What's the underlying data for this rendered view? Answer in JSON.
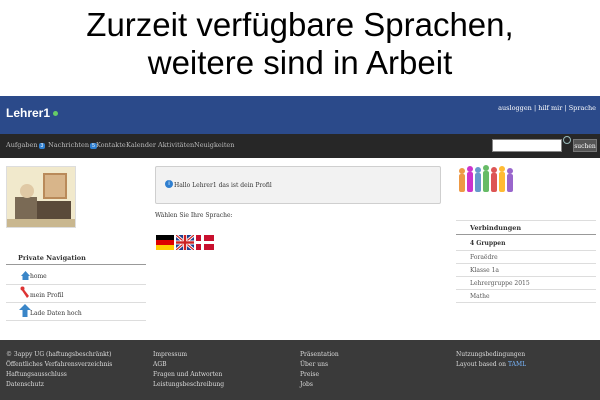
{
  "caption": {
    "line1": "Zurzeit verfügbare Sprachen,",
    "line2": "weitere sind in Arbeit"
  },
  "header": {
    "brand": "Lehrer1",
    "links": {
      "logout": "ausloggen",
      "help": "hilf mir",
      "language": "Sprache"
    }
  },
  "nav": {
    "tasks": "Aufgaben",
    "tasks_count": "3",
    "messages": "Nachrichten",
    "messages_count": "5",
    "contacts": "Kontakte",
    "calendar": "Kalender",
    "activities": "Aktivitäten",
    "news": "Neuigkeiten",
    "search_button": "suchen",
    "search_value": ""
  },
  "sidebar": {
    "title": "Private Navigation",
    "items": [
      {
        "label": "home",
        "icon": "house-icon"
      },
      {
        "label": "mein Profil",
        "icon": "wrench-icon"
      },
      {
        "label": "Lade Daten hoch",
        "icon": "upload-arrow-icon"
      }
    ]
  },
  "main": {
    "hello": "Hallo Lehrer1 das ist dein Profil",
    "lang_prompt": "Wählen Sie Ihre Sprache:",
    "flags": [
      "german-flag-icon",
      "uk-flag-icon",
      "danish-flag-icon"
    ]
  },
  "connections": {
    "title": "Verbindungen",
    "items": [
      "4 Gruppen",
      "Foraëdre",
      "Klasse 1a",
      "Lehrergruppe 2015",
      "Mathe"
    ]
  },
  "footer": {
    "col1": [
      "© 3appy UG (haftungsbeschränkt)",
      "Öffentliches Verfahrensverzeichnis",
      "Haftungsausschluss",
      "Datenschutz"
    ],
    "col2": [
      "Impressum",
      "AGB",
      "Fragen und Antworten",
      "Leistungsbeschreibung"
    ],
    "col3": [
      "Präsentation",
      "Über uns",
      "Preise",
      "Jobs"
    ],
    "col4_line1": "Nutzungsbedingungen",
    "col4_prefix": "Layout based on",
    "col4_link": "TAML"
  },
  "colors": {
    "topbar": "#2b4a8a",
    "navbar": "#272727",
    "footer": "#3a3a3a",
    "accent": "#2f7fd0"
  }
}
